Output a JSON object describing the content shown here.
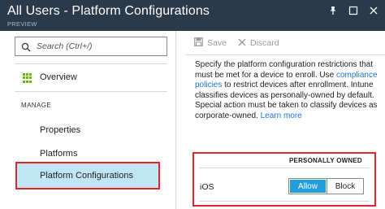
{
  "header": {
    "title": "All Users - Platform Configurations",
    "subtitle": "PREVIEW",
    "icons": [
      "pin-icon",
      "maximize-icon",
      "close-icon"
    ]
  },
  "sidebar": {
    "search_placeholder": "Search (Ctrl+/)",
    "overview_label": "Overview",
    "section_label": "MANAGE",
    "items": [
      {
        "label": "Properties",
        "selected": false
      },
      {
        "label": "Platforms",
        "selected": false
      },
      {
        "label": "Platform Configurations",
        "selected": true
      }
    ]
  },
  "toolbar": {
    "save_label": "Save",
    "discard_label": "Discard"
  },
  "description": {
    "text_before": "Specify the platform configuration restrictions that must be met for a device to enroll. Use ",
    "link1": "compliance policies",
    "text_after": " to restrict devices after enrollment. Intune classifies devices as personally-owned by default. Special action must be taken to classify devices as corporate-owned. ",
    "link2": "Learn more"
  },
  "personally_owned": {
    "header": "PERSONALLY OWNED",
    "platform": "iOS",
    "options": [
      "Allow",
      "Block"
    ],
    "selected": "Allow"
  },
  "colors": {
    "header_bg": "#2b3a4b",
    "selected_nav_bg": "#c0e6f6",
    "highlight_red": "#e0242b",
    "toggle_active": "#1f9fdb",
    "link": "#1f74d1",
    "overview_icon": "#6bb700"
  }
}
